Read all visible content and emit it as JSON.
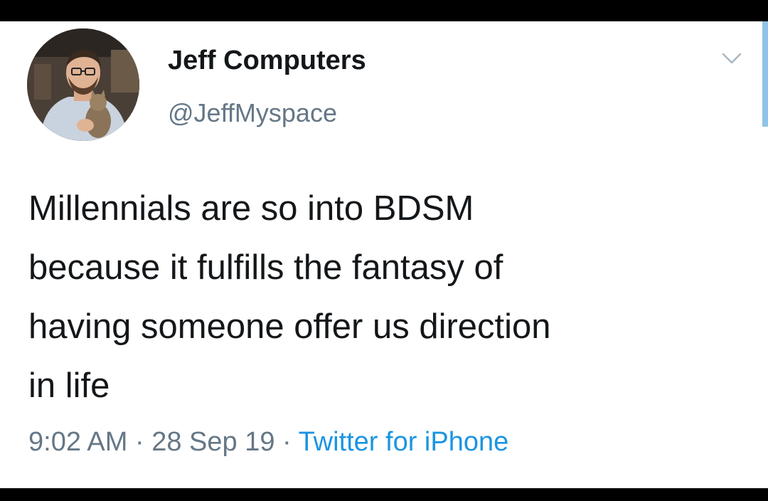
{
  "tweet": {
    "author": {
      "display_name": "Jeff Computers",
      "handle": "@JeffMyspace"
    },
    "text_lines": [
      "Millennials are so into BDSM",
      "because it fulfills the fantasy of",
      "having someone offer us direction",
      "in life"
    ],
    "time": "9:02 AM",
    "separator": " · ",
    "date": "28 Sep 19",
    "source": "Twitter for iPhone"
  },
  "colors": {
    "text_primary": "#14171a",
    "text_secondary": "#657786",
    "link": "#1b95e0",
    "background": "#ffffff",
    "frame": "#000000"
  },
  "icons": {
    "menu": "chevron-down-icon",
    "avatar": "profile-photo"
  }
}
